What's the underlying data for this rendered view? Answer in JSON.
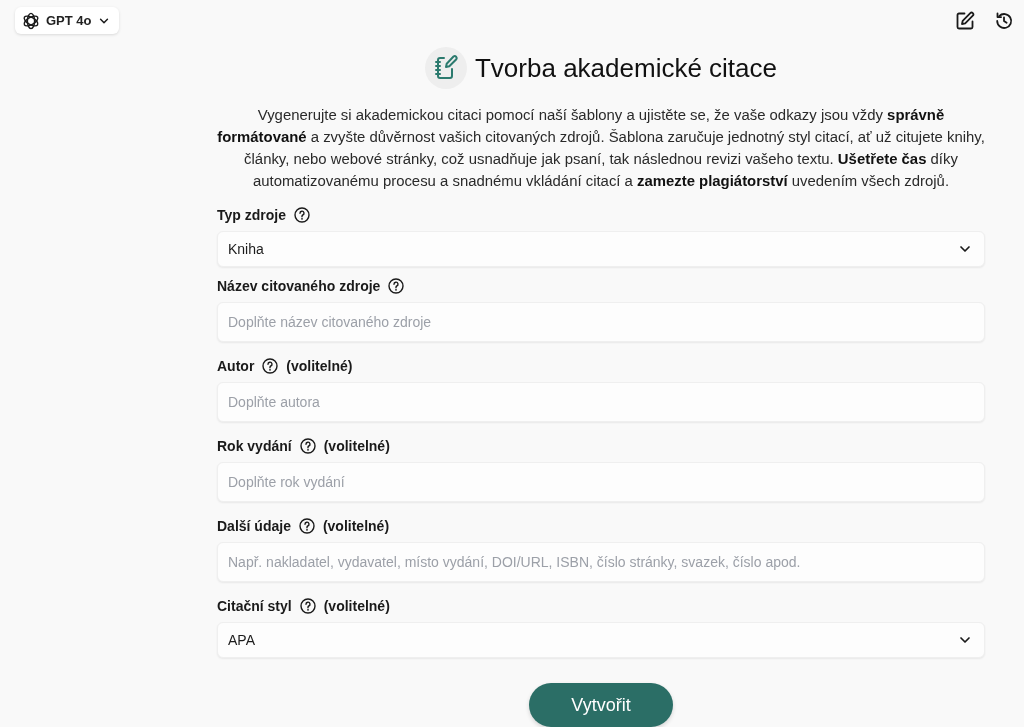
{
  "model_selector": {
    "label": "GPT 4o"
  },
  "header": {
    "title": "Tvorba akademické citace",
    "description": "Vygenerujte si akademickou citaci pomocí naší šablony a ujistěte se, že vaše odkazy jsou vždy **správně formátované** a zvyšte důvěrnost vašich citovaných zdrojů. Šablona zaručuje jednotný styl citací, ať už citujete knihy, články, nebo webové stránky, což usnadňuje jak psaní, tak následnou revizi vašeho textu. **Ušetřete čas** díky automatizovanému procesu a snadnému vkládání citací a **zamezte plagiátorství** uvedením všech zdrojů."
  },
  "fields": [
    {
      "kind": "select",
      "label": "Typ zdroje",
      "value": "Kniha"
    },
    {
      "kind": "input",
      "label": "Název citovaného zdroje",
      "placeholder": "Doplňte název citovaného zdroje"
    },
    {
      "kind": "input",
      "label": "Autor",
      "note": "(volitelné)",
      "placeholder": "Doplňte autora"
    },
    {
      "kind": "input",
      "label": "Rok vydání",
      "note": "(volitelné)",
      "placeholder": "Doplňte rok vydání"
    },
    {
      "kind": "input",
      "label": "Další údaje",
      "note": "(volitelné)",
      "placeholder": "Např. nakladatel, vydavatel, místo vydání, DOI/URL, ISBN, číslo stránky, svazek, číslo apod."
    },
    {
      "kind": "select",
      "label": "Citační styl",
      "note": "(volitelné)",
      "value": "APA"
    }
  ],
  "submit_button": {
    "label": "Vytvořit"
  }
}
